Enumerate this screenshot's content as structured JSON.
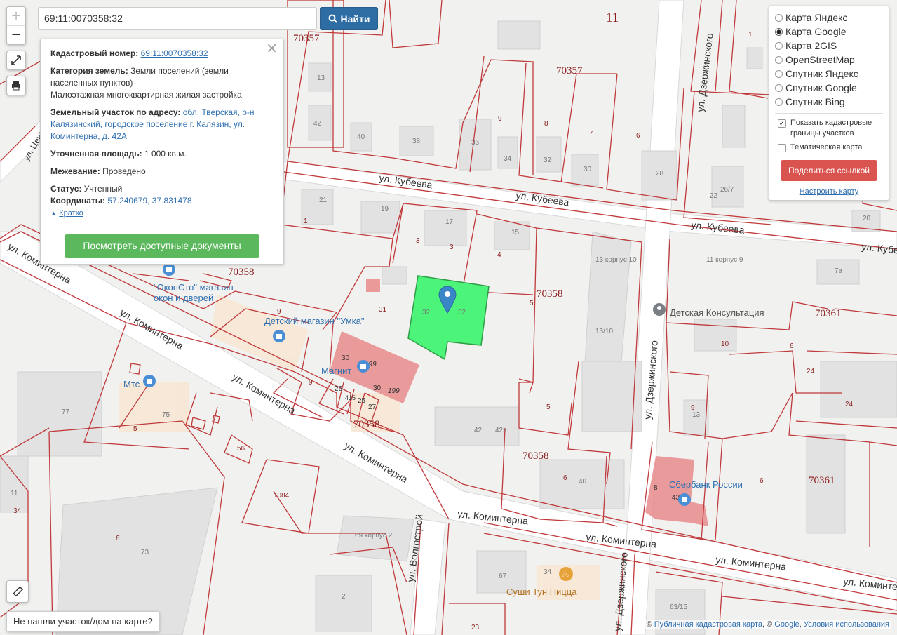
{
  "search": {
    "query": "69:11:0070358:32",
    "button_label": "Найти"
  },
  "zoom": {
    "in": "+",
    "out": "−"
  },
  "info": {
    "cadastral_label": "Кадастровый номер:",
    "cadastral_value": "69:11:0070358:32",
    "category_label": "Категория земель:",
    "category_value": "Земли поселений (земли населенных пунктов)",
    "category_use": "Малоэтажная многоквартирная жилая застройка",
    "address_label": "Земельный участок по адресу:",
    "address_value": "обл. Тверская, р-н Калязинский, городское поселение г. Калязин, ул. Коминтерна, д. 42А",
    "area_label": "Уточненная площадь:",
    "area_value": "1 000 кв.м.",
    "survey_label": "Межевание:",
    "survey_value": "Проведено",
    "status_label": "Статус:",
    "status_value": "Учтенный",
    "coords_label": "Координаты:",
    "coords_value": "57.240679, 37.831478",
    "brief_label": "Кратко",
    "docs_button": "Посмотреть доступные документы",
    "close": "×"
  },
  "layers": {
    "options": [
      {
        "label": "Карта Яндекс",
        "selected": false
      },
      {
        "label": "Карта Google",
        "selected": true
      },
      {
        "label": "Карта 2GIS",
        "selected": false
      },
      {
        "label": "OpenStreetMap",
        "selected": false
      },
      {
        "label": "Спутник Яндекс",
        "selected": false
      },
      {
        "label": "Спутник Google",
        "selected": false
      },
      {
        "label": "Спутник Bing",
        "selected": false
      }
    ],
    "show_borders_label": "Показать кадастровые границы участков",
    "show_borders_checked": true,
    "thematic_label": "Тематическая карта",
    "thematic_checked": false,
    "share_button": "Поделиться ссылкой",
    "settings_link": "Настроить карту"
  },
  "not_found_button": "Не нашли участок/дом на карте?",
  "attribution": {
    "copy": "©",
    "pkk": "Публичная кадастровая карта",
    "sep": ", ©",
    "google": "Google",
    "terms": "Условия использования"
  },
  "map": {
    "quarters": [
      "11",
      "70357",
      "70357",
      "70358",
      "70358",
      "70358",
      "70358",
      "70361",
      "70361"
    ],
    "parcel_numbers": [
      "1",
      "13",
      "42",
      "40",
      "38",
      "36",
      "34",
      "9",
      "8",
      "7",
      "6",
      "32",
      "30",
      "28",
      "26/7",
      "22",
      "20",
      "21",
      "19",
      "17",
      "15",
      "3",
      "3",
      "4",
      "1",
      "13 корпус 10",
      "11 корпус 9",
      "7а",
      "31",
      "32",
      "32",
      "5",
      "13/10",
      "10",
      "11",
      "6",
      "24",
      "24",
      "9",
      "30",
      "199",
      "26",
      "415",
      "25",
      "27",
      "30",
      "199",
      "9",
      "77",
      "5",
      "75",
      "56",
      "42",
      "42в",
      "5",
      "1084",
      "6",
      "40",
      "9",
      "13",
      "8",
      "43",
      "6",
      "11",
      "34",
      "6",
      "73",
      "69 корпус 2",
      "67",
      "34",
      "2",
      "23",
      "63/15"
    ],
    "streets": [
      "ул. Кубеева",
      "ул. Кубеева",
      "ул. Кубеева",
      "ул. Кубеева",
      "ул. Коминтерна",
      "ул. Коминтерна",
      "ул. Коминтерна",
      "ул. Коминтерна",
      "ул. Коминтерна",
      "ул. Коминтерна",
      "ул. Коминтерна",
      "ул. Коминтерна",
      "ул. Дзержинского",
      "ул. Дзержинского",
      "ул. Дзержинского",
      "ул. Волгострой",
      "ул. Центр"
    ],
    "pois": [
      "\"ОконСто\" магазин",
      "окон и дверей",
      "Детский магазин \"Умка\"",
      "Магнит",
      "Мтс",
      "Детская Консультация",
      "Сбербанк России",
      "Суши Тун Пицца"
    ],
    "colors": {
      "boundary": "#c0393b",
      "selected_parcel": "#4cf57a",
      "building_highlight": "#e88b8b"
    }
  }
}
